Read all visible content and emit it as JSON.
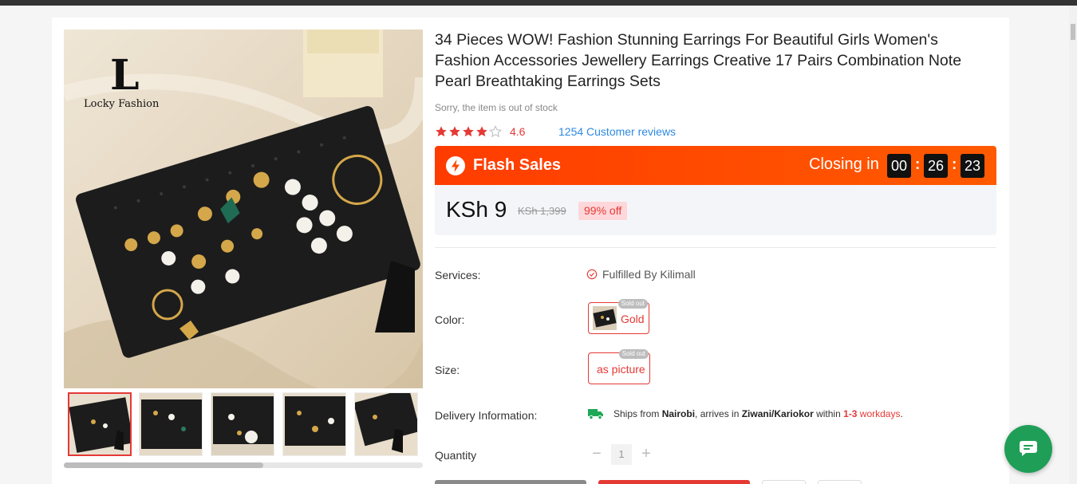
{
  "product": {
    "title": "34 Pieces WOW! Fashion Stunning Earrings For Beautiful Girls Women's Fashion Accessories Jewellery Earrings Creative 17 Pairs Combination Note Pearl Breathtaking Earrings Sets",
    "stock_status": "Sorry, the item is out of stock",
    "rating": "4.6",
    "rating_stars": 4,
    "reviews": "1254 Customer reviews",
    "brand_logo_text": "Locky Fashion",
    "brand_logo_letter": "L"
  },
  "flash_sale": {
    "label": "Flash Sales",
    "closing_label": "Closing in",
    "hours": "00",
    "minutes": "26",
    "seconds": "23",
    "color": "#ff4a00"
  },
  "pricing": {
    "price": "KSh 9",
    "old_price": "KSh 1,399",
    "discount": "99% off"
  },
  "details": {
    "services_label": "Services:",
    "services_value": "Fulfilled By Kilimall",
    "color_label": "Color:",
    "color_value": "Gold",
    "size_label": "Size:",
    "size_value": "as picture",
    "sold_out": "Sold out",
    "delivery_label": "Delivery Information:",
    "delivery": {
      "ships_from_prefix": "Ships from ",
      "ships_from": "Nairobi",
      "arrives_prefix": ", arrives in ",
      "arrives_in": "Ziwani/Kariokor",
      "within_prefix": " within ",
      "within": "1-3",
      "workdays": " workdays",
      "period": "."
    },
    "quantity_label": "Quantity",
    "quantity_value": "1",
    "minus": "−",
    "plus": "+"
  },
  "colors": {
    "accent": "#e53935",
    "link": "#2f8ae0",
    "chat": "#1f9e57"
  }
}
